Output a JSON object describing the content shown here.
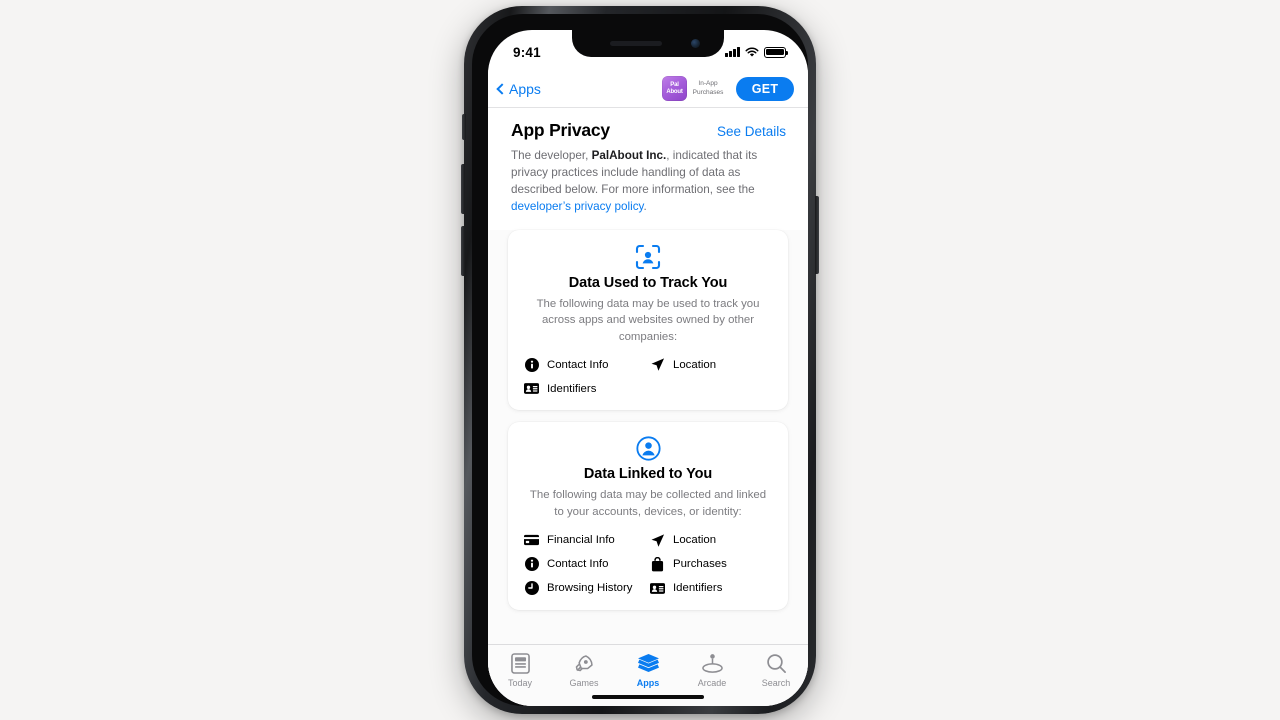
{
  "status_bar": {
    "time": "9:41",
    "cellular_icon": "signal-bars-icon",
    "wifi_icon": "wifi-icon",
    "battery_icon": "battery-full-icon"
  },
  "nav_bar": {
    "back_label": "Apps",
    "back_icon": "chevron-left-icon",
    "app_icon_line1": "Pal",
    "app_icon_line2": "About",
    "in_app_purchases_label": "In-App\nPurchases",
    "get_button_label": "GET"
  },
  "privacy_header": {
    "title": "App Privacy",
    "see_details_label": "See Details"
  },
  "privacy_description": {
    "part1": "The developer, ",
    "developer_name": "PalAbout Inc.",
    "part2": ", indicated that its privacy practices include handling of data as described below. For more information, see the ",
    "policy_link": "developer’s privacy policy",
    "part3": "."
  },
  "cards": [
    {
      "icon": "track-person-viewfinder-icon",
      "title": "Data Used to Track You",
      "description": "The following data may be used to track you across apps and websites owned by other companies:",
      "items": [
        {
          "label": "Contact Info",
          "icon": "info-circle-icon"
        },
        {
          "label": "Location",
          "icon": "location-arrow-icon"
        },
        {
          "label": "Identifiers",
          "icon": "id-card-icon"
        }
      ]
    },
    {
      "icon": "person-circle-icon",
      "title": "Data Linked to You",
      "description": "The following data may be collected and linked to your accounts, devices, or identity:",
      "items": [
        {
          "label": "Financial Info",
          "icon": "credit-card-icon"
        },
        {
          "label": "Location",
          "icon": "location-arrow-icon"
        },
        {
          "label": "Contact Info",
          "icon": "info-circle-icon"
        },
        {
          "label": "Purchases",
          "icon": "shopping-bag-icon"
        },
        {
          "label": "Browsing History",
          "icon": "clock-icon"
        },
        {
          "label": "Identifiers",
          "icon": "id-card-icon"
        }
      ]
    }
  ],
  "tab_bar": {
    "items": [
      {
        "label": "Today",
        "icon": "today-card-icon",
        "active": false
      },
      {
        "label": "Games",
        "icon": "rocket-icon",
        "active": false
      },
      {
        "label": "Apps",
        "icon": "layers-icon",
        "active": true
      },
      {
        "label": "Arcade",
        "icon": "joystick-icon",
        "active": false
      },
      {
        "label": "Search",
        "icon": "search-icon",
        "active": false
      }
    ]
  },
  "colors": {
    "accent_blue": "#0a7cf0",
    "page_background": "#f5f4f3",
    "card_background": "#ffffff",
    "secondary_text": "#6e6e73",
    "inactive_tab": "#8e8e93"
  }
}
